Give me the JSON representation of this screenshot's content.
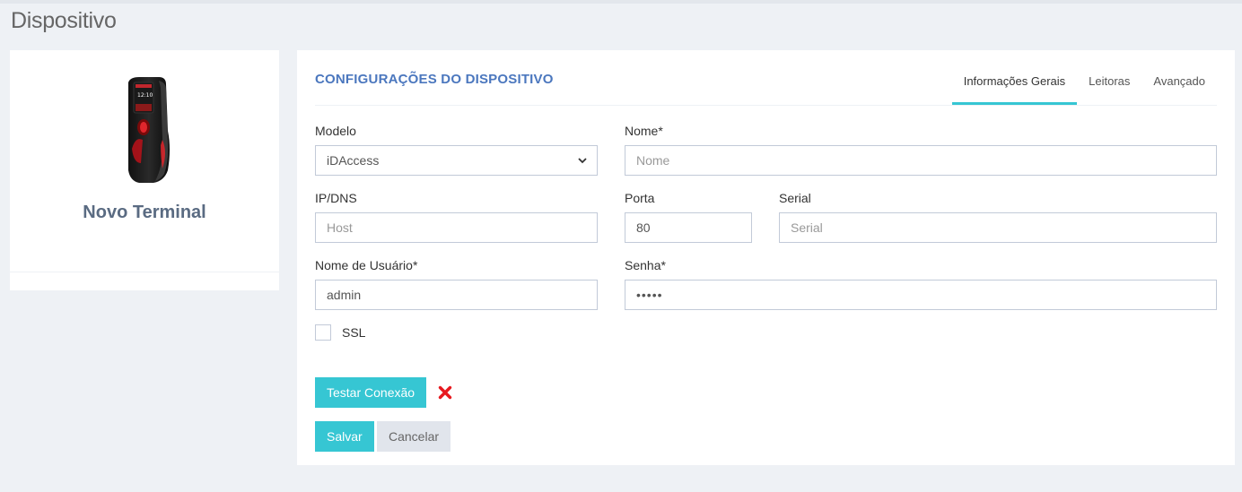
{
  "page": {
    "title": "Dispositivo"
  },
  "device": {
    "name": "Novo Terminal",
    "screen_text": "12:10"
  },
  "config": {
    "title": "CONFIGURAÇÕES DO DISPOSITIVO",
    "tabs": [
      {
        "label": "Informações Gerais",
        "active": true
      },
      {
        "label": "Leitoras",
        "active": false
      },
      {
        "label": "Avançado",
        "active": false
      }
    ],
    "fields": {
      "modelo": {
        "label": "Modelo",
        "value": "iDAccess"
      },
      "nome": {
        "label": "Nome*",
        "placeholder": "Nome",
        "value": ""
      },
      "ip": {
        "label": "IP/DNS",
        "placeholder": "Host",
        "value": ""
      },
      "porta": {
        "label": "Porta",
        "value": "80"
      },
      "serial": {
        "label": "Serial",
        "placeholder": "Serial",
        "value": ""
      },
      "usuario": {
        "label": "Nome de Usuário*",
        "value": "admin"
      },
      "senha": {
        "label": "Senha*",
        "value": "•••••"
      }
    },
    "ssl": {
      "label": "SSL",
      "checked": false
    },
    "buttons": {
      "test": "Testar Conexão",
      "save": "Salvar",
      "cancel": "Cancelar"
    },
    "connection_status_icon": "close-icon",
    "colors": {
      "accent": "#36c6d3",
      "title": "#4b77be",
      "error": "#e7191f"
    }
  }
}
